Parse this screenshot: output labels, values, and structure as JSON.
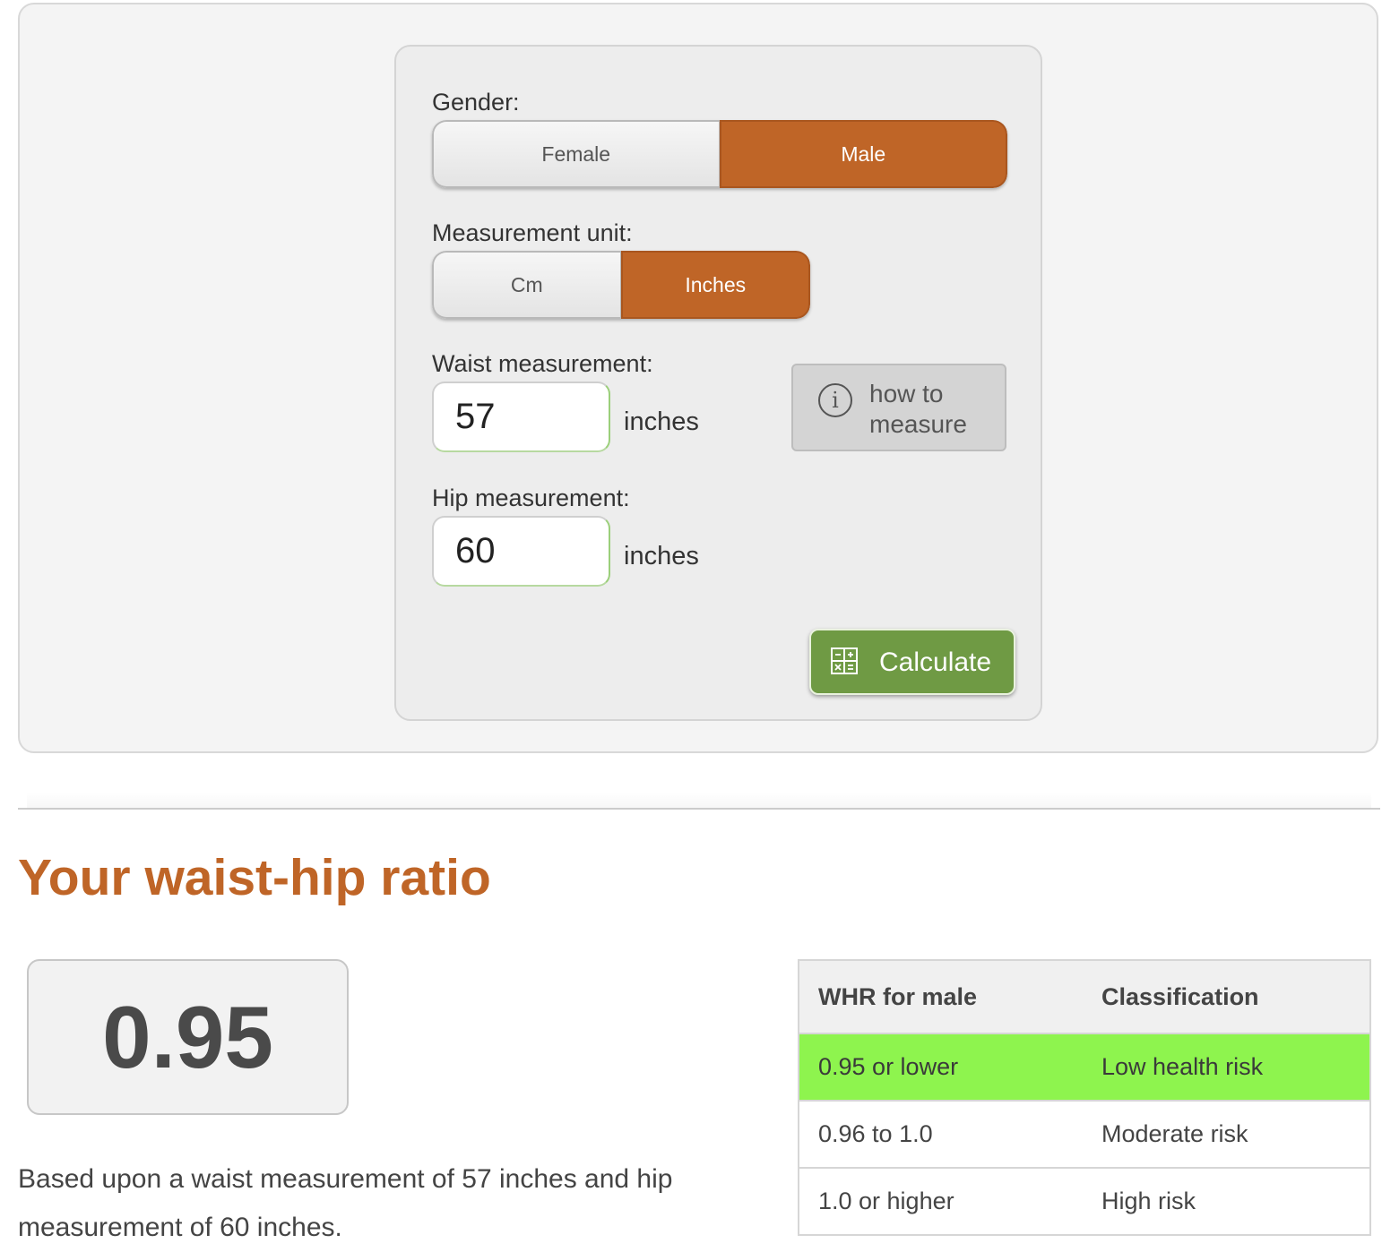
{
  "form": {
    "gender": {
      "label": "Gender:",
      "options": [
        "Female",
        "Male"
      ],
      "selected": "Male"
    },
    "unit": {
      "label": "Measurement unit:",
      "options": [
        "Cm",
        "Inches"
      ],
      "selected": "Inches"
    },
    "waist": {
      "label": "Waist measurement:",
      "value": "57",
      "unit": "inches"
    },
    "hip": {
      "label": "Hip measurement:",
      "value": "60",
      "unit": "inches"
    },
    "how_to_measure": {
      "line1": "how to",
      "line2": "measure",
      "icon": "info-icon"
    },
    "calculate": {
      "label": "Calculate",
      "icon": "calculator-icon"
    }
  },
  "result": {
    "title": "Your waist-hip ratio",
    "ratio": "0.95",
    "description": "Based upon a waist measurement of 57 inches and hip measurement of 60 inches."
  },
  "table": {
    "headers": [
      "WHR for male",
      "Classification"
    ],
    "rows": [
      [
        "0.95 or lower",
        "Low health risk"
      ],
      [
        "0.96 to 1.0",
        "Moderate risk"
      ],
      [
        "1.0 or higher",
        "High risk"
      ]
    ],
    "highlighted_row": 0
  },
  "colors": {
    "accent": "#bf6527",
    "calculate_button": "#6f9a44",
    "highlight_row": "#8ef44e"
  }
}
